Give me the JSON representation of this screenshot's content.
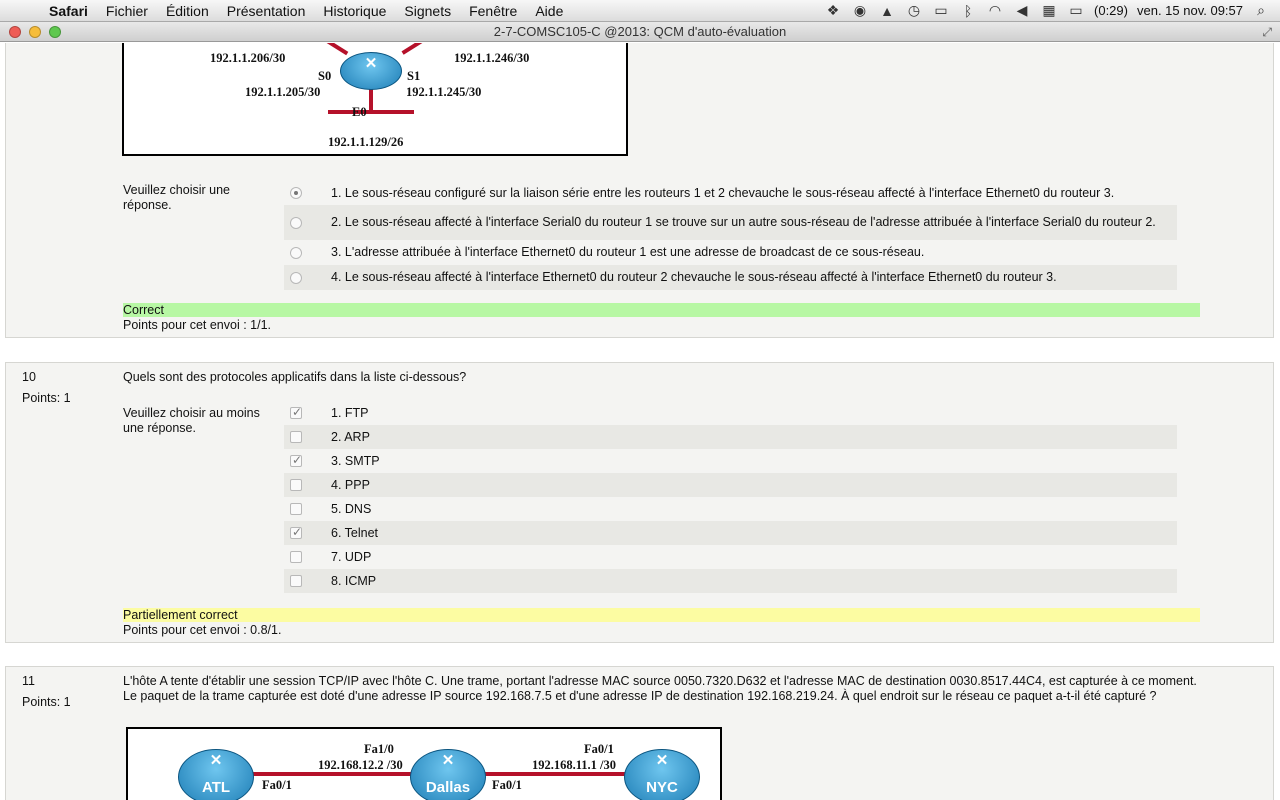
{
  "menubar": {
    "apple_icon": "apple-icon",
    "items": [
      "Safari",
      "Fichier",
      "Édition",
      "Présentation",
      "Historique",
      "Signets",
      "Fenêtre",
      "Aide"
    ],
    "battery": "(0:29)",
    "datetime": "ven. 15 nov.  09:57"
  },
  "window": {
    "title": "2-7-COMSC105-C @2013: QCM d'auto-évaluation"
  },
  "diagram1": {
    "ip_s0_net": "192.1.1.206/30",
    "ip_s1_net": "192.1.1.246/30",
    "s0": "S0",
    "s1": "S1",
    "ip_s0": "192.1.1.205/30",
    "ip_s1": "192.1.1.245/30",
    "e0": "E0",
    "ip_e0": "192.1.1.129/26"
  },
  "q9": {
    "prompt": "Veuillez choisir une réponse.",
    "options": [
      "1. Le sous-réseau configuré sur la liaison série entre les routeurs 1 et 2 chevauche le sous-réseau affecté à l'interface Ethernet0 du routeur 3.",
      "2. Le sous-réseau affecté à l'interface Serial0 du routeur 1 se trouve sur un autre sous-réseau de l'adresse attribuée à l'interface Serial0 du routeur 2.",
      "3. L'adresse attribuée à l'interface Ethernet0 du routeur 1 est une adresse de broadcast de ce sous-réseau.",
      "4. Le sous-réseau affecté à l'interface Ethernet0 du routeur 2 chevauche le sous-réseau affecté à l'interface Ethernet0 du routeur 3."
    ],
    "selected": 0,
    "feedback": "Correct",
    "points": "Points pour cet envoi : 1/1."
  },
  "q10": {
    "number": "10",
    "points_label": "Points: 1",
    "question": "Quels sont des protocoles applicatifs dans la liste ci-dessous?",
    "prompt": "Veuillez choisir au moins une réponse.",
    "options": [
      "1. FTP",
      "2. ARP",
      "3. SMTP",
      "4. PPP",
      "5. DNS",
      "6. Telnet",
      "7. UDP",
      "8. ICMP"
    ],
    "checked": [
      true,
      false,
      true,
      false,
      false,
      true,
      false,
      false
    ],
    "feedback": "Partiellement correct",
    "points": "Points pour cet envoi : 0.8/1."
  },
  "q11": {
    "number": "11",
    "points_label": "Points: 1",
    "question": "L'hôte A tente d'établir une session TCP/IP avec l'hôte C. Une trame, portant l'adresse MAC source 0050.7320.D632 et l'adresse MAC de destination 0030.8517.44C4, est capturée à ce moment. Le paquet de la trame capturée est doté d'une adresse IP source 192.168.7.5 et d'une adresse IP de destination 192.168.219.24. À quel endroit sur le réseau ce paquet a-t-il été capturé ?"
  },
  "diagram2": {
    "atl": "ATL",
    "dallas": "Dallas",
    "nyc": "NYC",
    "fa10": "Fa1/0",
    "ip_dallas_left": "192.168.12.2 /30",
    "fa00": "Fa0/1",
    "ip_dallas_right": "192.168.11.1 /30",
    "atl_fa01": "Fa0/1",
    "dallas_fa01": "Fa0/1"
  }
}
